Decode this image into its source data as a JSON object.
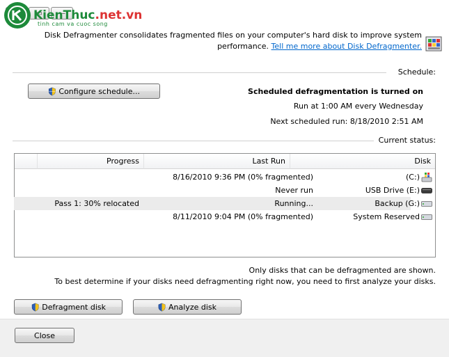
{
  "window": {
    "close_glyph": "✕",
    "restore_glyph": "▭",
    "minimize_glyph": "—"
  },
  "watermark": {
    "brand": "KienThuc",
    "tld": ".net.vn",
    "sub": "tinh cam va cuoc song"
  },
  "intro": {
    "line1": "Disk Defragmenter consolidates fragmented files on your computer's hard disk to improve system",
    "line2": "performance.",
    "link": "Tell me more about Disk Defragmenter."
  },
  "schedule": {
    "heading": "Schedule:",
    "status": "Scheduled defragmentation is turned on",
    "run_at": "Run at 1:00 AM every Wednesday",
    "next_run": "Next scheduled run: 8/18/2010 2:51 AM",
    "configure_label": "Configure schedule..."
  },
  "current_status": {
    "heading": "Current status:",
    "columns": [
      "Disk",
      "Last Run",
      "Progress"
    ],
    "rows": [
      {
        "disk": "(C:)",
        "last_run": "8/16/2010 9:36 PM (0% fragmented)",
        "progress": "",
        "icon": "system-drive-icon"
      },
      {
        "disk": "USB Drive (E:)",
        "last_run": "Never run",
        "progress": "",
        "icon": "usb-drive-icon"
      },
      {
        "disk": "Backup (G:)",
        "last_run": "Running...",
        "progress": "Pass 1: 30% relocated",
        "icon": "hard-drive-icon"
      },
      {
        "disk": "System Reserved",
        "last_run": "8/11/2010 9:04 PM (0% fragmented)",
        "progress": "",
        "icon": "hard-drive-icon"
      }
    ]
  },
  "notes": {
    "line1": "Only disks that can be defragmented are shown.",
    "line2": "To best determine if your disks need defragmenting right now, you need to first analyze your disks."
  },
  "actions": {
    "analyze_label": "Analyze disk",
    "defragment_label": "Defragment disk",
    "close_label": "Close"
  }
}
